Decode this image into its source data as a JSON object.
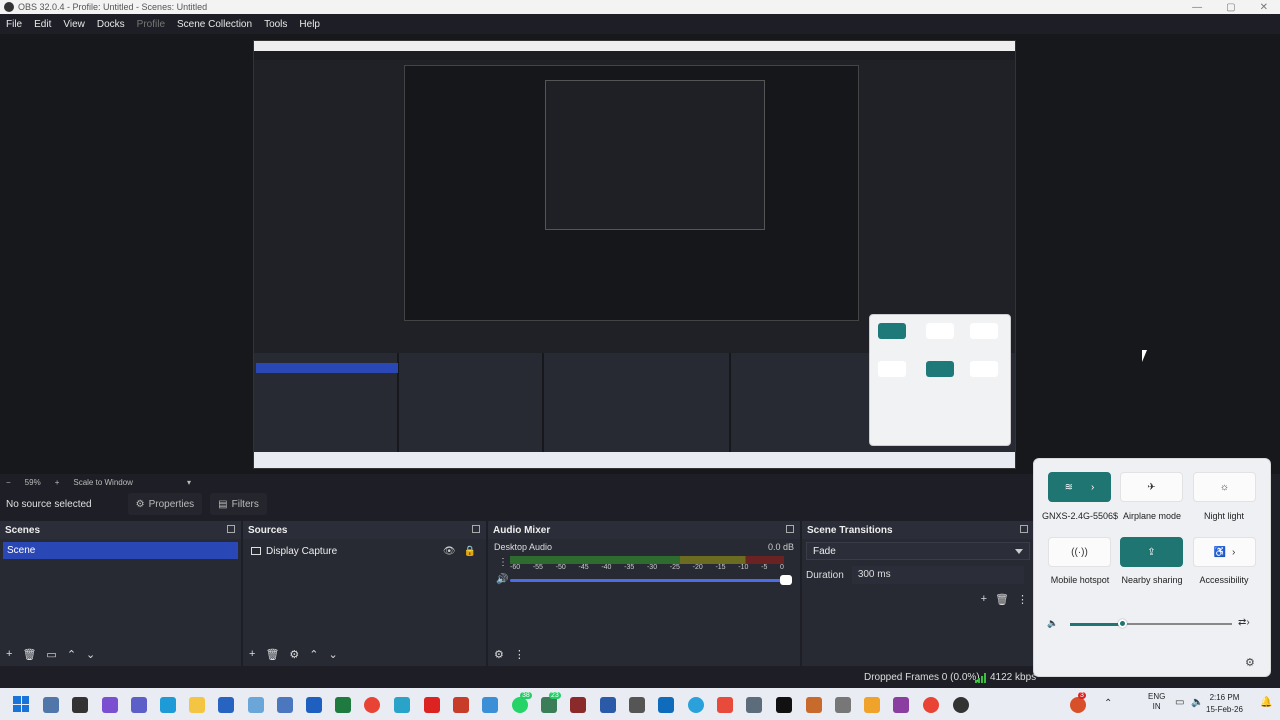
{
  "window": {
    "title": "OBS 32.0.4 - Profile: Untitled - Scenes: Untitled"
  },
  "menu": [
    "File",
    "Edit",
    "View",
    "Docks",
    "Profile",
    "Scene Collection",
    "Tools",
    "Help"
  ],
  "preview_toolbar": {
    "minus": "−",
    "zoom": "59%",
    "plus": "+",
    "scale_mode": "Scale to Window"
  },
  "source_status": {
    "text": "No source selected",
    "properties": "Properties",
    "filters": "Filters"
  },
  "docks": {
    "scenes": {
      "title": "Scenes",
      "items": [
        "Scene"
      ],
      "footer": [
        "+",
        "🗑",
        "▭",
        "⌃",
        "⌄"
      ]
    },
    "sources": {
      "title": "Sources",
      "items": [
        {
          "name": "Display Capture"
        }
      ],
      "footer": [
        "+",
        "🗑",
        "⚙",
        "⌃",
        "⌄"
      ]
    },
    "audio_mixer": {
      "title": "Audio Mixer",
      "channel": "Desktop Audio",
      "db": "0.0 dB",
      "ticks": [
        "-60",
        "-55",
        "-50",
        "-45",
        "-40",
        "-35",
        "-30",
        "-25",
        "-20",
        "-15",
        "-10",
        "-5",
        "0"
      ],
      "volume_level": 1.0
    },
    "scene_transitions": {
      "title": "Scene Transitions",
      "transition": "Fade",
      "duration_label": "Duration",
      "duration_value": "300 ms"
    }
  },
  "status_bar": {
    "dropped_frames": "Dropped Frames 0 (0.0%)",
    "bitrate": "4122 kbps"
  },
  "quick_settings": {
    "tiles": [
      {
        "label": "GNXS-2.4G-5506$",
        "on": true,
        "icon": "wifi-icon"
      },
      {
        "label": "Airplane mode",
        "on": false,
        "icon": "airplane-icon"
      },
      {
        "label": "Night light",
        "on": false,
        "icon": "sun-icon"
      },
      {
        "label": "Mobile hotspot",
        "on": false,
        "icon": "hotspot-icon"
      },
      {
        "label": "Nearby sharing",
        "on": true,
        "icon": "share-icon"
      },
      {
        "label": "Accessibility",
        "on": false,
        "icon": "accessibility-icon"
      }
    ],
    "volume_level": 0.32
  },
  "taskbar": {
    "language_top": "ENG",
    "language_bottom": "IN",
    "time": "2:16 PM",
    "date": "15-Feb-26",
    "badges": [
      "38",
      "23",
      "3"
    ]
  },
  "colors": {
    "obs_bg": "#1e1f26",
    "dock_bg": "#272a33",
    "selection": "#2a47b6",
    "accent_teal": "#1e7572",
    "slider_blue": "#4d6ce8"
  }
}
